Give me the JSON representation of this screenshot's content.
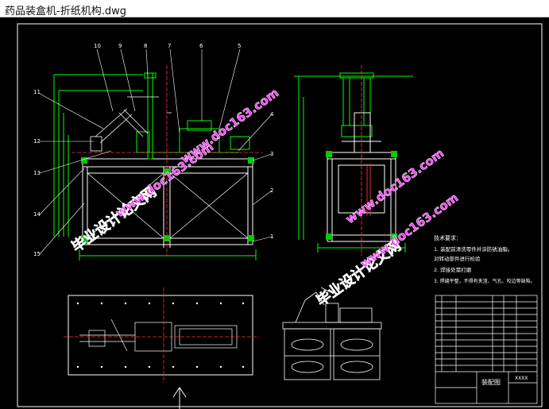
{
  "window": {
    "title": "药品装盒机-折纸机构.dwg"
  },
  "drawing": {
    "part_numbers": [
      "10",
      "9",
      "8",
      "7",
      "6",
      "5",
      "4",
      "3",
      "2",
      "1",
      "11",
      "12",
      "13",
      "14",
      "15"
    ],
    "watermarks": {
      "site_cn": "毕业设计论文网",
      "site_url": "www.doc163.com"
    },
    "tech_requirements": {
      "heading": "技术要求：",
      "items": [
        "1. 装配前清洗零件并涂防锈油脂。",
        "对转动部件进行检验",
        "2. 焊接处需打磨",
        "3. 焊缝平整，不得有夹渣、气孔、咬边等缺陷。"
      ]
    },
    "title_block": {
      "name": "装配图",
      "code": "XXXX"
    }
  }
}
